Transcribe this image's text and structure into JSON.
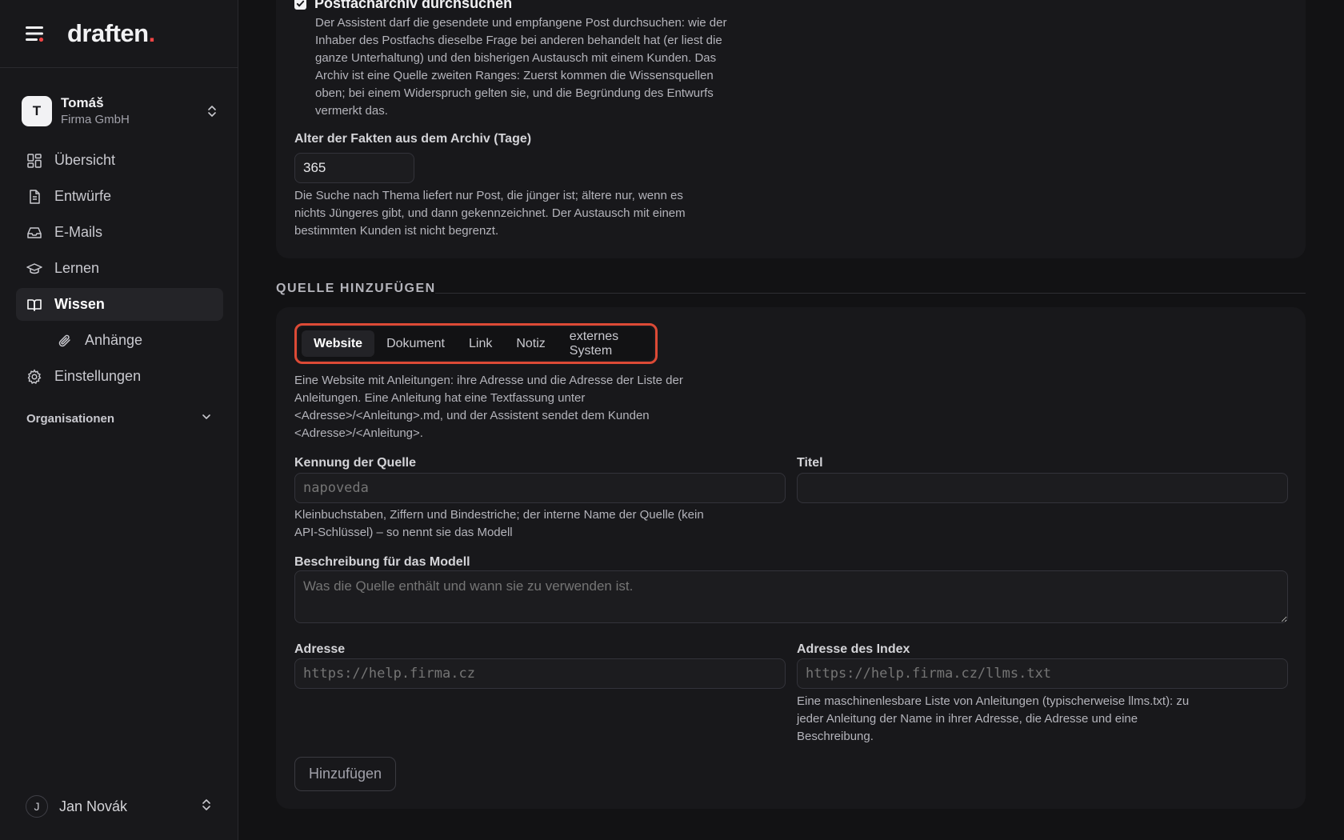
{
  "brand": {
    "name": "draften",
    "dot": "."
  },
  "org": {
    "initial": "T",
    "name": "Tomáš",
    "company": "Firma GmbH"
  },
  "nav": {
    "overview": "Übersicht",
    "drafts": "Entwürfe",
    "emails": "E-Mails",
    "learn": "Lernen",
    "knowledge": "Wissen",
    "attachments": "Anhänge",
    "settings": "Einstellungen",
    "organizations": "Organisationen"
  },
  "user": {
    "initial": "J",
    "name": "Jan Novák"
  },
  "archive": {
    "checkbox_label": "Postfacharchiv durchsuchen",
    "checked": true,
    "description": "Der Assistent darf die gesendete und empfangene Post durchsuchen: wie der Inhaber des Postfachs dieselbe Frage bei anderen behandelt hat (er liest die ganze Unterhaltung) und den bisherigen Austausch mit einem Kunden. Das Archiv ist eine Quelle zweiten Ranges: Zuerst kommen die Wissensquellen oben; bei einem Widerspruch gelten sie, und die Begründung des Entwurfs vermerkt das.",
    "age_label": "Alter der Fakten aus dem Archiv (Tage)",
    "age_value": "365",
    "age_help": "Die Suche nach Thema liefert nur Post, die jünger ist; ältere nur, wenn es nichts Jüngeres gibt, und dann gekennzeichnet. Der Austausch mit einem bestimmten Kunden ist nicht begrenzt."
  },
  "add_source": {
    "section_title": "QUELLE HINZUFÜGEN",
    "tabs": [
      "Website",
      "Dokument",
      "Link",
      "Notiz",
      "externes System"
    ],
    "active_tab": "Website",
    "tab_description": "Eine Website mit Anleitungen: ihre Adresse und die Adresse der Liste der Anleitungen. Eine Anleitung hat eine Textfassung unter <Adresse>/<Anleitung>.md, und der Assistent sendet dem Kunden <Adresse>/<Anleitung>.",
    "id_label": "Kennung der Quelle",
    "id_placeholder": "napoveda",
    "id_help": "Kleinbuchstaben, Ziffern und Bindestriche; der interne Name der Quelle (kein API-Schlüssel) – so nennt sie das Modell",
    "title_label": "Titel",
    "title_value": "",
    "desc_label": "Beschreibung für das Modell",
    "desc_placeholder": "Was die Quelle enthält und wann sie zu verwenden ist.",
    "url_label": "Adresse",
    "url_placeholder": "https://help.firma.cz",
    "index_label": "Adresse des Index",
    "index_placeholder": "https://help.firma.cz/llms.txt",
    "index_help": "Eine maschinenlesbare Liste von Anleitungen (typischerweise llms.txt): zu jeder Anleitung der Name in ihrer Adresse, die Adresse und eine Beschreibung.",
    "submit_label": "Hinzufügen"
  },
  "colors": {
    "accent_outline": "#dc4a36",
    "logo_dot": "#ef4444",
    "background": "#121214",
    "card": "#18181b"
  },
  "icons": [
    "menu-icon",
    "chevron-up-down-icon",
    "dashboard-icon",
    "document-icon",
    "inbox-icon",
    "graduation-cap-icon",
    "book-icon",
    "paperclip-icon",
    "gear-icon",
    "chevron-down-icon",
    "check-icon"
  ]
}
